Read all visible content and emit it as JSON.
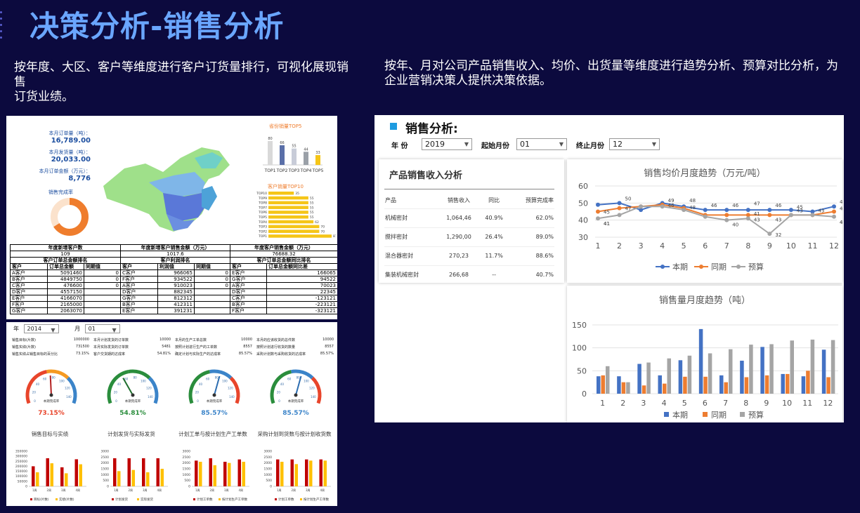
{
  "page": {
    "title": "决策分析-销售分析",
    "desc_left": "按年度、大区、客户等维度进行客户订货量排行，可视化展现销售",
    "desc_left_2": "订货业绩。",
    "desc_right": "按年、月对公司产品销售收入、均价、出货量等维度进行趋势分析、预算对比分析，为企业营销决策人提供决策依据。"
  },
  "p1": {
    "kpis": [
      {
        "label": "本月订单量（吨）：",
        "value": "16,789.00"
      },
      {
        "label": "本月发货量（吨）：",
        "value": "20,033.00"
      },
      {
        "label": "本月订单金额（万元）：",
        "value": "8,776"
      }
    ],
    "completion_label": "销售完成率",
    "completion_value": "66%",
    "completion_pct": 0.66,
    "province_top5": {
      "title": "省份销量TOP5",
      "labels": [
        "TOP1",
        "TOP2",
        "TOP3",
        "TOP4",
        "TOP5"
      ],
      "values": [
        80,
        66,
        55,
        44,
        33
      ]
    },
    "customer_top10": {
      "title": "客户销量TOP10",
      "labels": [
        "TOP10",
        "TOP9",
        "TOP8",
        "TOP7",
        "TOP6",
        "TOP5",
        "TOP4",
        "TOP3",
        "TOP2",
        "TOP1"
      ],
      "values": [
        35,
        55,
        55,
        55,
        55,
        55,
        62,
        70,
        70,
        87
      ]
    },
    "summary": [
      {
        "title": "年度新增客户数",
        "value": "109"
      },
      {
        "title": "年度新增客户销售金额（万元）",
        "value": "1017.6"
      },
      {
        "title": "年度客户销售金额（万元）",
        "value": "76688.32"
      }
    ],
    "rank_titles": [
      "客户订单总金额排名",
      "客户利润排名",
      "客户订单总金额同比排名"
    ],
    "rank_headers": [
      [
        "客户",
        "订单总金额",
        "同期值"
      ],
      [
        "客户",
        "利润值",
        "同期值"
      ],
      [
        "客户",
        "订单总金额同比差"
      ]
    ],
    "rank_rows": [
      [
        "A客户",
        "5091460",
        "0",
        "C客户",
        "966065",
        "0",
        "E客户",
        "166065"
      ],
      [
        "B客户",
        "4849750",
        "0",
        "F客户",
        "934522",
        "0",
        "G客户",
        "94522"
      ],
      [
        "C客户",
        "476600",
        "0",
        "A客户",
        "910023",
        "0",
        "A客户",
        "70023"
      ],
      [
        "D客户",
        "4557150",
        "",
        "D客户",
        "882345",
        "",
        "D客户",
        "22345"
      ],
      [
        "E客户",
        "4166070",
        "",
        "G客户",
        "812312",
        "",
        "C客户",
        "-123121"
      ],
      [
        "F客户",
        "2165000",
        "",
        "B客户",
        "412311",
        "",
        "B客户",
        "-223121"
      ],
      [
        "G客户",
        "2063070",
        "",
        "E客户",
        "391231",
        "",
        "F客户",
        "-323121"
      ]
    ]
  },
  "p2": {
    "year_label": "年",
    "year_value": "2014",
    "month_label": "月",
    "month_value": "01",
    "stats": [
      [
        [
          "销售目标(片数)",
          "1000000"
        ],
        [
          "销售实绩(片数)",
          "731500"
        ],
        [
          "销售实绩占销售目标的百分比",
          "73.15%"
        ]
      ],
      [
        [
          "本月计划发货的订单数",
          "10000"
        ],
        [
          "本月实际发货的订单数",
          "5481"
        ],
        [
          "客户交货期的达成率",
          "54.81%"
        ]
      ],
      [
        [
          "本月的生产工单总数",
          "10000"
        ],
        [
          "按照计划进行生产的工单数",
          "8557"
        ],
        [
          "确定计划与实际生产的达成率",
          "85.57%"
        ]
      ],
      [
        [
          "本月的应该收货的总件数",
          "10000"
        ],
        [
          "按照计划进行收货的数量",
          "8557"
        ],
        [
          "采购计划数与采购收货的达成率",
          "85.57%"
        ]
      ]
    ],
    "gauges": [
      {
        "value": "73.15%",
        "pct": 73.15,
        "label": "本期完成率",
        "color": "#e8452b"
      },
      {
        "value": "54.81%",
        "pct": 54.81,
        "label": "本期完成率",
        "color": "#2a8d3c"
      },
      {
        "value": "85.57%",
        "pct": 85.57,
        "label": "本期完成率",
        "color": "#3b84c9"
      },
      {
        "value": "85.57%",
        "pct": 85.57,
        "label": "本期完成率",
        "color": "#3b84c9"
      }
    ],
    "gauge_ticks": [
      "0",
      "10",
      "20",
      "30",
      "40",
      "50",
      "60",
      "70",
      "80",
      "90",
      "100",
      "110",
      "120",
      "130",
      "140",
      "150"
    ],
    "mini_charts": [
      {
        "title": "销售目标与实绩",
        "ymax": 350000,
        "yticks": [
          "0",
          "50000",
          "100000",
          "150000",
          "200000",
          "250000",
          "300000",
          "350000"
        ],
        "categories": [
          "1周",
          "2周",
          "3周",
          "4周"
        ],
        "series": [
          {
            "name": "目标(片数)",
            "values": [
              200000,
              280000,
              190000,
              270000
            ]
          },
          {
            "name": "实绩(片数)",
            "values": [
              140000,
              230000,
              130000,
              220000
            ]
          }
        ]
      },
      {
        "title": "计划发货与实际发货",
        "ymax": 3000,
        "yticks": [
          "0",
          "500",
          "1000",
          "1500",
          "2000",
          "2500",
          "3000"
        ],
        "categories": [
          "1周",
          "2周",
          "3周",
          "4周"
        ],
        "series": [
          {
            "name": "计划发货",
            "values": [
              2400,
              2400,
              2400,
              2400
            ]
          },
          {
            "name": "实际发货",
            "values": [
              1300,
              1400,
              1200,
              1500
            ]
          }
        ]
      },
      {
        "title": "计划工单与按计划生产工单数",
        "ymax": 3000,
        "yticks": [
          "0",
          "500",
          "1000",
          "1500",
          "2000",
          "2500",
          "3000"
        ],
        "categories": [
          "1周",
          "2周",
          "3周",
          "4周"
        ],
        "series": [
          {
            "name": "计划工单数",
            "values": [
              2200,
              2400,
              2100,
              2300
            ]
          },
          {
            "name": "按计划生产工单数",
            "values": [
              2100,
              1800,
              2000,
              2100
            ]
          }
        ]
      },
      {
        "title": "采购计划到货数与按计划收货数",
        "ymax": 3000,
        "yticks": [
          "0",
          "500",
          "1000",
          "1500",
          "2000",
          "2500",
          "3000"
        ],
        "categories": [
          "1周",
          "2周",
          "3周",
          "4周"
        ],
        "series": [
          {
            "name": "计划工单数",
            "values": [
              2300,
              2300,
              2300,
              2300
            ]
          },
          {
            "name": "按计划生产工单数",
            "values": [
              2100,
              1900,
              2200,
              2200
            ]
          }
        ]
      }
    ]
  },
  "p3": {
    "title": "销售分析:",
    "year_label": "年  份",
    "year_value": "2019",
    "start_label": "起始月份",
    "start_value": "01",
    "end_label": "终止月份",
    "end_value": "12",
    "table_title": "产品销售收入分析",
    "table_headers": [
      "产品",
      "销售收入",
      "同比",
      "预算完成率"
    ],
    "table_rows": [
      [
        "机械密封",
        "1,064,46",
        "40.9%",
        "62.0%"
      ],
      [
        "搅拌密封",
        "1,290,00",
        "26.4%",
        "89.0%"
      ],
      [
        "混合器密封",
        "270,23",
        "11.7%",
        "88.6%"
      ],
      [
        "集装机械密封",
        "266,68",
        "--",
        "40.7%"
      ]
    ]
  },
  "chart_data": [
    {
      "type": "line",
      "title": "销售均价月度趋势（万元/吨）",
      "x": [
        "1",
        "2",
        "3",
        "4",
        "5",
        "6",
        "7",
        "8",
        "9",
        "10",
        "11",
        "12"
      ],
      "ylim": [
        30,
        60
      ],
      "yticks": [
        "30",
        "40",
        "50",
        "60"
      ],
      "series": [
        {
          "name": "本期",
          "color": "#4472c4",
          "values": [
            49,
            50,
            46,
            50,
            48,
            46,
            46,
            46,
            46,
            46,
            45,
            48
          ]
        },
        {
          "name": "同期",
          "color": "#ed7d31",
          "values": [
            45,
            47,
            48,
            49,
            47,
            43,
            43,
            43,
            43,
            43,
            43,
            45
          ]
        },
        {
          "name": "预算",
          "color": "#a5a5a5",
          "values": [
            41,
            43,
            48,
            48,
            46,
            42,
            40,
            41,
            32,
            43,
            43,
            42
          ]
        }
      ],
      "data_labels": [
        "50",
        "45",
        "47",
        "46",
        "41",
        "48",
        "49",
        "48",
        "46",
        "46",
        "47",
        "45",
        "43",
        "43",
        "42",
        "41",
        "40",
        "41",
        "32",
        "43",
        "43",
        "42",
        "46",
        "45",
        "48"
      ],
      "legend": "bottom"
    },
    {
      "type": "bar",
      "title": "销售量月度趋势（吨）",
      "categories": [
        "1",
        "2",
        "3",
        "4",
        "5",
        "6",
        "7",
        "8",
        "9",
        "10",
        "11",
        "12"
      ],
      "ylim": [
        0,
        150
      ],
      "yticks": [
        "0",
        "50",
        "100",
        "150"
      ],
      "series": [
        {
          "name": "本期",
          "color": "#4472c4",
          "values": [
            38,
            38,
            65,
            40,
            73,
            141,
            40,
            72,
            102,
            43,
            38,
            96
          ]
        },
        {
          "name": "同期",
          "color": "#ed7d31",
          "values": [
            40,
            25,
            18,
            22,
            37,
            37,
            25,
            36,
            40,
            43,
            50,
            36
          ]
        },
        {
          "name": "预算",
          "color": "#a5a5a5",
          "values": [
            60,
            25,
            68,
            77,
            83,
            88,
            97,
            107,
            108,
            116,
            118,
            117
          ]
        }
      ],
      "legend": "bottom"
    }
  ]
}
